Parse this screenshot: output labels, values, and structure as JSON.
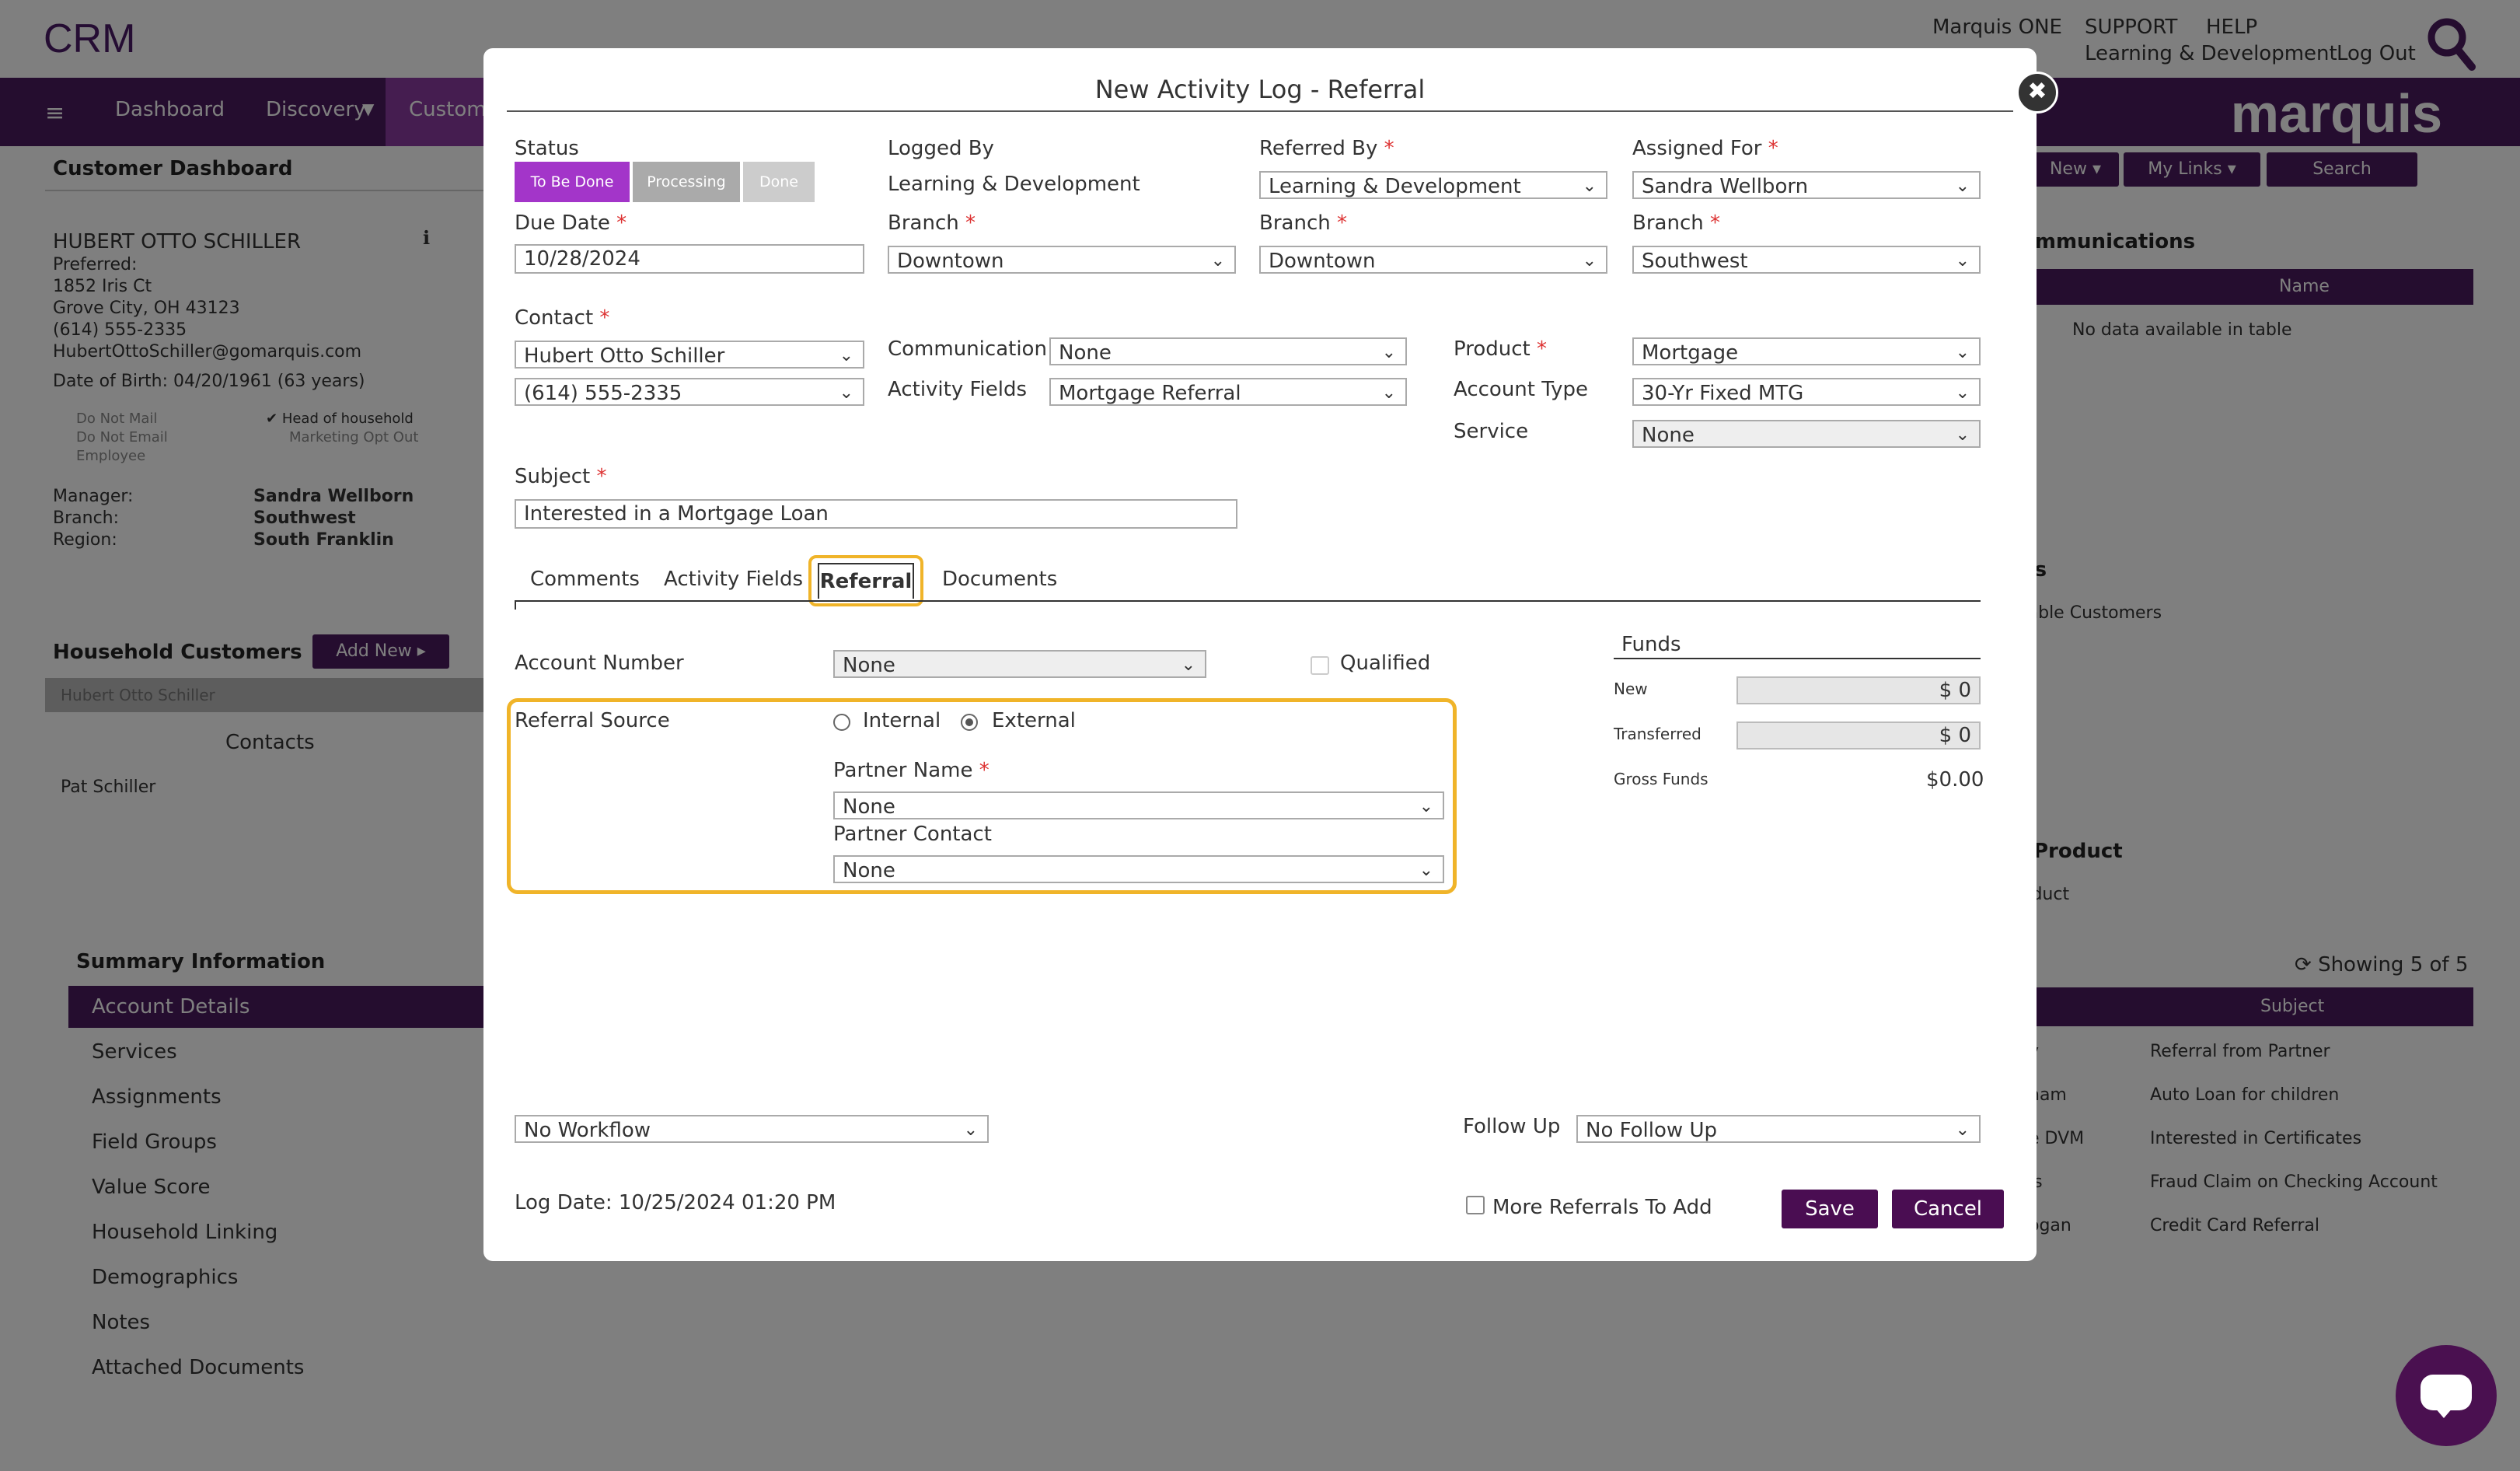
{
  "app": {
    "title": "CRM",
    "brand": "marquis"
  },
  "header": {
    "user": "Marquis ONE",
    "links": [
      "SUPPORT",
      "HELP"
    ],
    "department": "Learning & Development",
    "logout": "Log Out"
  },
  "nav": {
    "items": [
      "Dashboard",
      "Discovery",
      "Custome"
    ],
    "right_buttons": [
      "New",
      "My Links",
      "Search"
    ]
  },
  "customer": {
    "section_title": "Customer Dashboard",
    "name": "HUBERT OTTO SCHILLER",
    "preferred": "Preferred:",
    "street": "1852 Iris Ct",
    "city": "Grove City, OH 43123",
    "phone": "(614) 555-2335",
    "email": "HubertOttoSchiller@gomarquis.com",
    "dob": "Date of Birth: 04/20/1961 (63 years)",
    "flags": [
      "Do Not Mail",
      "Do Not Email",
      "Employee"
    ],
    "flags_right": [
      "Head of household",
      "Marketing Opt Out"
    ],
    "manager_label": "Manager:",
    "manager": "Sandra Wellborn",
    "branch_label": "Branch:",
    "branch": "Southwest",
    "region_label": "Region:",
    "region": "South Franklin"
  },
  "household": {
    "title": "Household Customers",
    "add_new": "Add New",
    "member": "Hubert Otto Schiller",
    "contacts_label": "Contacts",
    "contact": "Pat Schiller"
  },
  "summary": {
    "title": "Summary Information",
    "items": [
      "Account Details",
      "Services",
      "Assignments",
      "Field Groups",
      "Value Score",
      "Household Linking",
      "Demographics",
      "Notes",
      "Attached Documents"
    ]
  },
  "right_panels": {
    "communications_title": "ommunications",
    "name_col": "Name",
    "no_data": "No data available in table",
    "panel2_title": "es",
    "panel2_text": "table Customers",
    "product_title": "Product",
    "product_text": "oduct",
    "showing": "Showing 5 of 5",
    "subject_col": "Subject",
    "rows": [
      {
        "left": "y",
        "subject": "Referral from Partner"
      },
      {
        "left": "ham",
        "subject": "Auto Loan for children"
      },
      {
        "left": "e DVM",
        "subject": "Interested in Certificates"
      },
      {
        "left": "is",
        "subject": "Fraud Claim on Checking Account"
      },
      {
        "left": "ogan",
        "subject": "Credit Card Referral"
      }
    ]
  },
  "modal": {
    "title": "New Activity Log - Referral",
    "status": {
      "label": "Status",
      "buttons": [
        "To Be Done",
        "Processing",
        "Done"
      ]
    },
    "logged_by": {
      "label": "Logged By",
      "value": "Learning & Development"
    },
    "referred_by": {
      "label": "Referred By",
      "value": "Learning & Development"
    },
    "assigned_for": {
      "label": "Assigned For",
      "value": "Sandra Wellborn"
    },
    "due_date": {
      "label": "Due Date",
      "value": "10/28/2024"
    },
    "branch_label": "Branch",
    "branch1": "Downtown",
    "branch2": "Downtown",
    "branch3": "Southwest",
    "contact": {
      "label": "Contact",
      "value": "Hubert Otto Schiller",
      "phone": "(614) 555-2335"
    },
    "communication": {
      "label": "Communication",
      "value": "None"
    },
    "activity_fields": {
      "label": "Activity Fields",
      "value": "Mortgage Referral"
    },
    "product": {
      "label": "Product",
      "value": "Mortgage"
    },
    "account_type": {
      "label": "Account Type",
      "value": "30-Yr Fixed MTG"
    },
    "service": {
      "label": "Service",
      "value": "None"
    },
    "subject": {
      "label": "Subject",
      "value": "Interested in a Mortgage Loan"
    },
    "tabs": [
      "Comments",
      "Activity Fields",
      "Referral",
      "Documents"
    ],
    "account_number": {
      "label": "Account Number",
      "value": "None"
    },
    "qualified": "Qualified",
    "referral_source": {
      "label": "Referral Source",
      "internal": "Internal",
      "external": "External"
    },
    "partner_name": {
      "label": "Partner Name",
      "value": "None"
    },
    "partner_contact": {
      "label": "Partner Contact",
      "value": "None"
    },
    "funds": {
      "title": "Funds",
      "new_label": "New",
      "new_value": "$ 0",
      "transferred_label": "Transferred",
      "transferred_value": "$ 0",
      "gross_label": "Gross Funds",
      "gross_value": "$0.00"
    },
    "workflow": "No Workflow",
    "follow_up": {
      "label": "Follow Up",
      "value": "No Follow Up"
    },
    "log_date": "Log Date: 10/25/2024 01:20 PM",
    "more_referrals": "More Referrals To Add",
    "save": "Save",
    "cancel": "Cancel",
    "required_mark": "*"
  },
  "colors": {
    "brand_purple": "#4a1a5e",
    "status_active": "#a335c9",
    "status_inactive": "#aaaaaa",
    "highlight": "#f0b429",
    "button_dark": "#4a0d52"
  }
}
